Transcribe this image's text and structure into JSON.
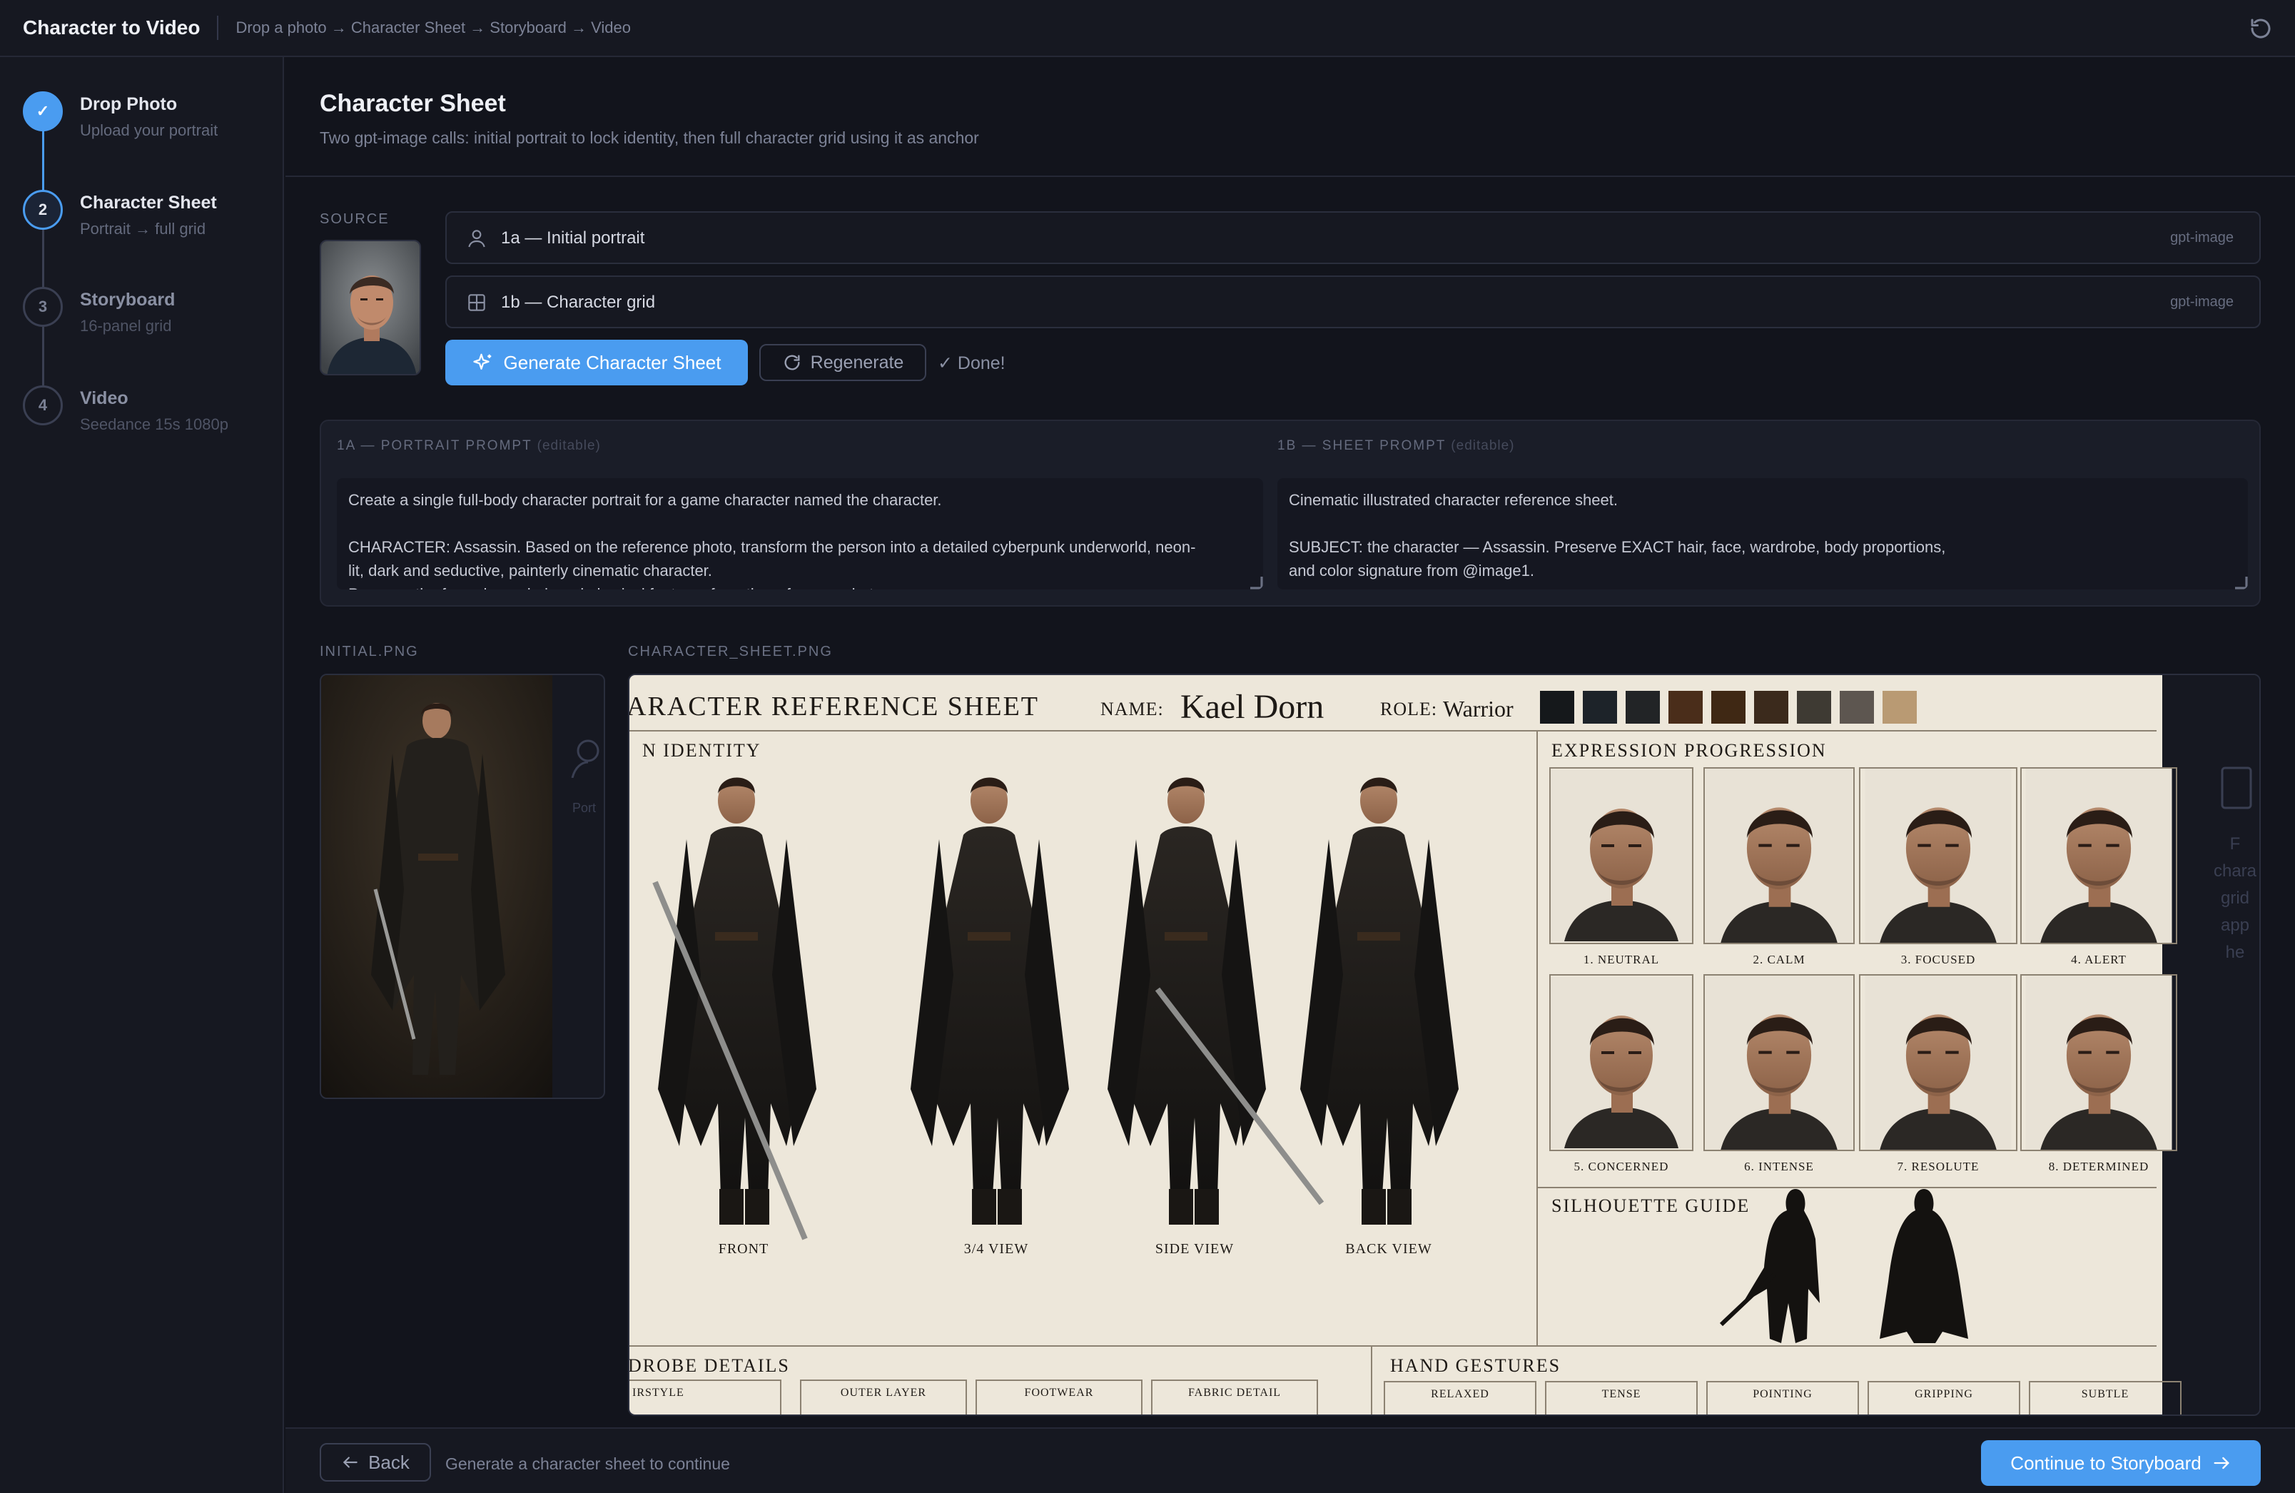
{
  "app": {
    "title": "Character to Video",
    "breadcrumb": "Drop a photo → Character Sheet → Storyboard → Video"
  },
  "steps": [
    {
      "number": "✓",
      "title": "Drop Photo",
      "subtitle": "Upload your portrait",
      "state": "done"
    },
    {
      "number": "2",
      "title": "Character Sheet",
      "subtitle": "Portrait → full grid",
      "state": "active"
    },
    {
      "number": "3",
      "title": "Storyboard",
      "subtitle": "16-panel grid",
      "state": "pending"
    },
    {
      "number": "4",
      "title": "Video",
      "subtitle": "Seedance 15s 1080p",
      "state": "pending"
    }
  ],
  "page": {
    "title": "Character Sheet",
    "subtitle": "Two gpt-image calls: initial portrait to lock identity, then full character grid using it as anchor"
  },
  "source": {
    "label": "SOURCE"
  },
  "generations": [
    {
      "label": "1a — Initial portrait",
      "model": "gpt-image",
      "icon": "user-icon"
    },
    {
      "label": "1b — Character grid",
      "model": "gpt-image",
      "icon": "grid-icon"
    }
  ],
  "actions": {
    "generate": "Generate Character Sheet",
    "regenerate": "Regenerate",
    "status": "✓ Done!"
  },
  "prompts": {
    "portrait": {
      "label": "1A — PORTRAIT PROMPT",
      "editable": "(editable)",
      "text": "Create a single full-body character portrait for a game character named the character.\n\nCHARACTER: Assassin. Based on the reference photo, transform the person into a detailed cyberpunk underworld, neon-\nlit, dark and seductive, painterly cinematic character.\nPreserve the face shape, hair and physical features from the reference photo."
    },
    "sheet": {
      "label": "1B — SHEET PROMPT",
      "editable": "(editable)",
      "text": "Cinematic illustrated character reference sheet.\n\nSUBJECT: the character — Assassin. Preserve EXACT hair, face, wardrobe, body proportions,\nand color signature from @image1."
    }
  },
  "outputs": {
    "initial_label": "INITIAL.PNG",
    "sheet_label": "CHARACTER_SHEET.PNG",
    "peek_left": "Port",
    "peek_right": [
      "F",
      "chara",
      "grid",
      "app",
      "he"
    ]
  },
  "sheet": {
    "title": "ARACTER REFERENCE SHEET",
    "name_label": "NAME:",
    "name": "Kael Dorn",
    "role_label": "ROLE:",
    "role": "Warrior",
    "swatches": [
      "#15181b",
      "#1d2329",
      "#222426",
      "#4a2d1a",
      "#3f2814",
      "#3b2a1c",
      "#3e3a33",
      "#5d5650",
      "#b99a73"
    ],
    "identity_title": "N IDENTITY",
    "views": [
      "FRONT",
      "3/4 VIEW",
      "SIDE VIEW",
      "BACK VIEW"
    ],
    "expression_title": "EXPRESSION PROGRESSION",
    "expressions": [
      "1. NEUTRAL",
      "2. CALM",
      "3. FOCUSED",
      "4. ALERT",
      "5. CONCERNED",
      "6. INTENSE",
      "7. RESOLUTE",
      "8. DETERMINED"
    ],
    "silhouette_title": "SILHOUETTE GUIDE",
    "wardrobe_title": "DROBE DETAILS",
    "wardrobe_items": [
      "IRSTYLE",
      "OUTER LAYER",
      "FOOTWEAR",
      "FABRIC DETAIL"
    ],
    "gestures_title": "HAND GESTURES",
    "gestures": [
      "RELAXED",
      "TENSE",
      "POINTING",
      "GRIPPING",
      "SUBTLE"
    ]
  },
  "footer": {
    "back": "Back",
    "hint": "Generate a character sheet to continue",
    "continue": "Continue to Storyboard"
  },
  "colors": {
    "accent": "#4a9cf0",
    "background": "#12141c",
    "panel": "#161821",
    "paper": "#ede7da"
  }
}
